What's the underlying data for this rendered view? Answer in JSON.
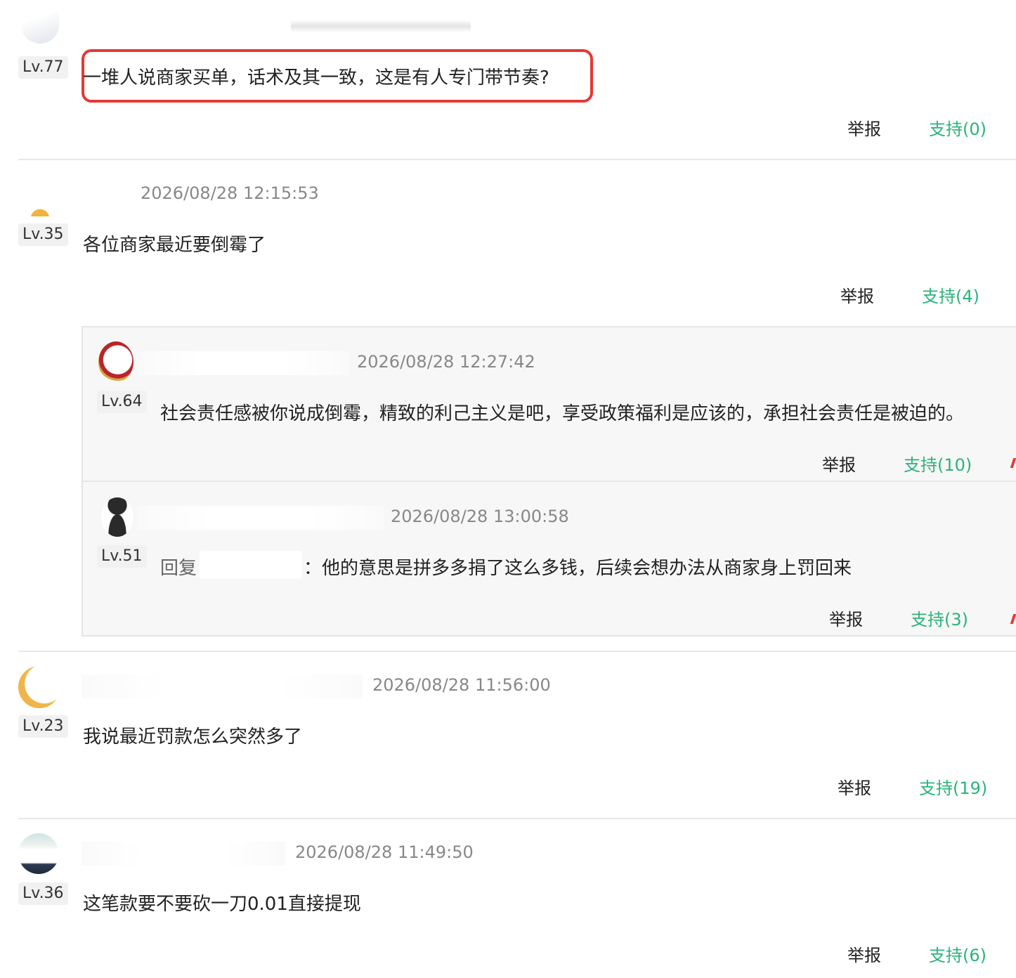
{
  "comments": [
    {
      "level": "Lv.77",
      "content": "一堆人说商家买单，话术及其一致，这是有人专门带节奏?",
      "report": "举报",
      "support": "支持(0)"
    },
    {
      "level": "Lv.35",
      "time": "2026/08/28 12:15:53",
      "content": "各位商家最近要倒霉了",
      "report": "举报",
      "support": "支持(4)",
      "replies": [
        {
          "level": "Lv.64",
          "time": "2026/08/28 12:27:42",
          "content": "社会责任感被你说成倒霉，精致的利己主义是吧，享受政策福利是应该的，承担社会责任是被迫的。",
          "report": "举报",
          "support": "支持(10)"
        },
        {
          "level": "Lv.51",
          "time": "2026/08/28 13:00:58",
          "reply_prefix": "回复",
          "content": "：他的意思是拼多多捐了这么多钱，后续会想办法从商家身上罚回来",
          "report": "举报",
          "support": "支持(3)"
        }
      ]
    },
    {
      "level": "Lv.23",
      "time": "2026/08/28 11:56:00",
      "content": "我说最近罚款怎么突然多了",
      "report": "举报",
      "support": "支持(19)"
    },
    {
      "level": "Lv.36",
      "time": "2026/08/28 11:49:50",
      "content": "这笔款要不要砍一刀0.01直接提现",
      "report": "举报",
      "support": "支持(6)"
    }
  ],
  "colors": {
    "support": "#2bb37a",
    "highlight_border": "#e53935",
    "reply_bg": "#f7f7f7"
  }
}
